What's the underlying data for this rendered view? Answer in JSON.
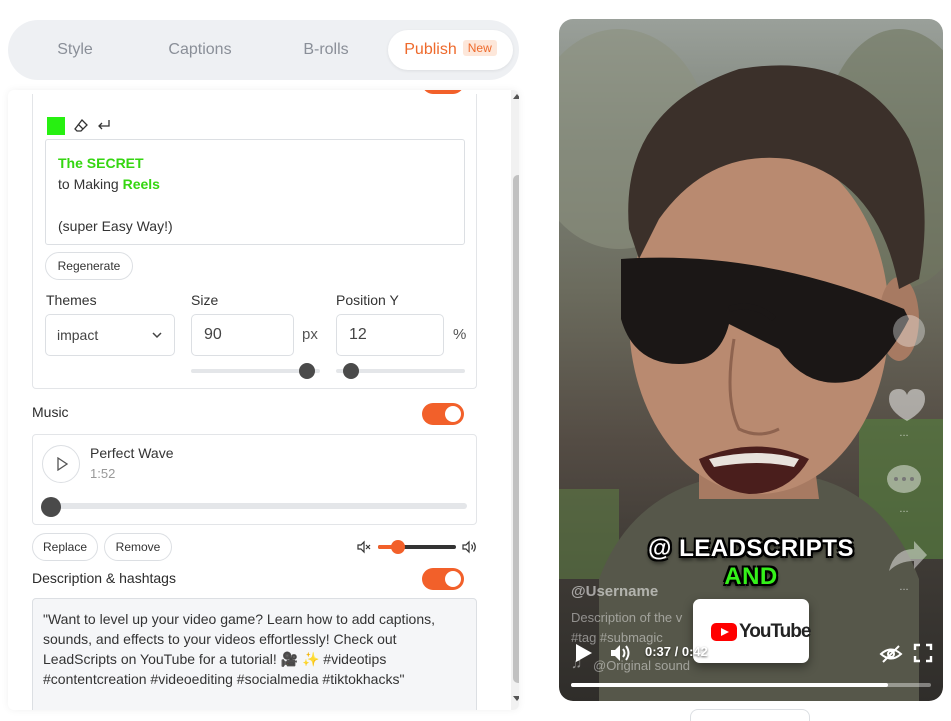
{
  "tabs": [
    {
      "label": "Style"
    },
    {
      "label": "Captions"
    },
    {
      "label": "B-rolls"
    },
    {
      "label": "Publish",
      "badge": "New",
      "active": true
    }
  ],
  "hook": {
    "swatch_color": "#27f011",
    "line1": "The SECRET",
    "line2_prefix": "to Making",
    "line2_highlight": "Reels",
    "line3": "(super Easy Way!)",
    "regenerate_label": "Regenerate"
  },
  "settings": {
    "themes_label": "Themes",
    "theme_value": "impact",
    "size_label": "Size",
    "size_value": "90",
    "size_unit": "px",
    "size_slider_fraction": 0.9,
    "position_label": "Position Y",
    "position_value": "12",
    "position_unit": "%",
    "position_slider_fraction": 0.12
  },
  "music": {
    "label": "Music",
    "enabled": true,
    "track_name": "Perfect Wave",
    "track_duration": "1:52",
    "playback_fraction": 0,
    "replace_label": "Replace",
    "remove_label": "Remove",
    "volume_fraction": 0.25
  },
  "description": {
    "label": "Description & hashtags",
    "enabled": true,
    "text": "\"Want to level up your video game? Learn how to add captions, sounds, and effects to your videos effortlessly! Check out LeadScripts on YouTube for a tutorial! 🎥 ✨ #videotips #contentcreation #videoediting #socialmedia #tiktokhacks\""
  },
  "preview": {
    "caption_line1": "@ LEADSCRIPTS",
    "caption_line2": "AND",
    "username": "@Username",
    "description": "Description of the v",
    "tags": "#tag #submagic",
    "sound": "@Original sound",
    "time": "0:37 / 0:42",
    "progress_fraction": 0.88,
    "youtube_label": "YouTube",
    "like_count": "...",
    "comment_count": "...",
    "share_count": "..."
  },
  "colors": {
    "accent": "#ee6a2c",
    "toggle": "#f2602a",
    "caption_green": "#35f01a"
  }
}
